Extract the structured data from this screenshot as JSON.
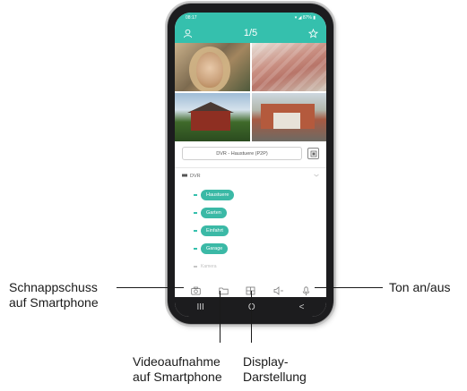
{
  "phone": {
    "status_time": "08:17",
    "status_right": "▾ ◢ 87% ▮",
    "app_title": "1/5",
    "cameras": [
      {
        "label": ""
      },
      {
        "label": ""
      },
      {
        "label": ""
      },
      {
        "label": ""
      }
    ],
    "channel_select": "DVR - Haustuere (P2P)",
    "tree": {
      "root_label": "DVR",
      "items": [
        "Haustuere",
        "Garten",
        "Einfahrt",
        "Garage"
      ],
      "disabled_item": "Kamera"
    },
    "toolbar_icons": [
      "camera-icon",
      "folder-icon",
      "grid-icon",
      "speaker-icon",
      "mic-icon"
    ],
    "nav": {
      "recent": "III",
      "home": "O",
      "back": "<"
    },
    "accent_color": "#35c0ad"
  },
  "callouts": {
    "snapshot": {
      "line1": "Schnappschuss",
      "line2": "auf Smartphone"
    },
    "video": {
      "line1": "Videoaufnahme",
      "line2": "auf Smartphone"
    },
    "display": {
      "line1": "Display-",
      "line2": "Darstellung"
    },
    "sound": {
      "line1": "Ton an/aus"
    }
  }
}
